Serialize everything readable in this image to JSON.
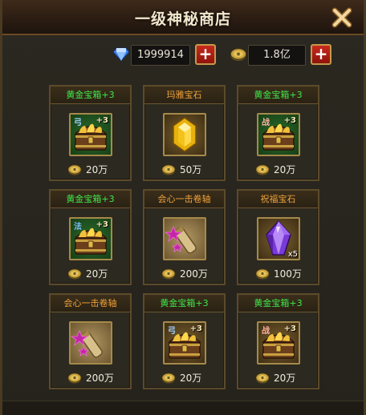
{
  "window": {
    "title": "一级神秘商店"
  },
  "currency": {
    "diamond_icon": "diamond-icon",
    "diamond_value": "1999914",
    "gold_icon": "gold-coin-icon",
    "gold_value": "1.8亿",
    "add_label": "+"
  },
  "colors": {
    "green_name": "#3fe84a",
    "orange_name": "#f0a23a",
    "price_text": "#f0ece0",
    "plus_button": "#c8291d"
  },
  "items": [
    {
      "name": "黄金宝箱+3",
      "icon": "golden-chest-icon",
      "tag": "弓",
      "plus": "+3",
      "count": "",
      "price": "20万"
    },
    {
      "name": "玛雅宝石",
      "icon": "yellow-gem-icon",
      "tag": "",
      "plus": "",
      "count": "",
      "price": "50万"
    },
    {
      "name": "黄金宝箱+3",
      "icon": "golden-chest-icon",
      "tag": "战",
      "plus": "+3",
      "count": "",
      "price": "20万"
    },
    {
      "name": "黄金宝箱+3",
      "icon": "golden-chest-icon",
      "tag": "法",
      "plus": "+3",
      "count": "",
      "price": "20万"
    },
    {
      "name": "会心一击卷轴",
      "icon": "scroll-icon",
      "tag": "",
      "plus": "",
      "count": "",
      "price": "200万"
    },
    {
      "name": "祝福宝石",
      "icon": "purple-gem-icon",
      "tag": "",
      "plus": "",
      "count": "x5",
      "price": "100万"
    },
    {
      "name": "会心一击卷轴",
      "icon": "scroll-icon",
      "tag": "",
      "plus": "",
      "count": "",
      "price": "200万"
    },
    {
      "name": "黄金宝箱+3",
      "icon": "golden-chest-icon",
      "tag": "弓",
      "plus": "+3",
      "count": "",
      "price": "20万"
    },
    {
      "name": "黄金宝箱+3",
      "icon": "golden-chest-icon",
      "tag": "战",
      "plus": "+3",
      "count": "",
      "price": "20万"
    }
  ]
}
